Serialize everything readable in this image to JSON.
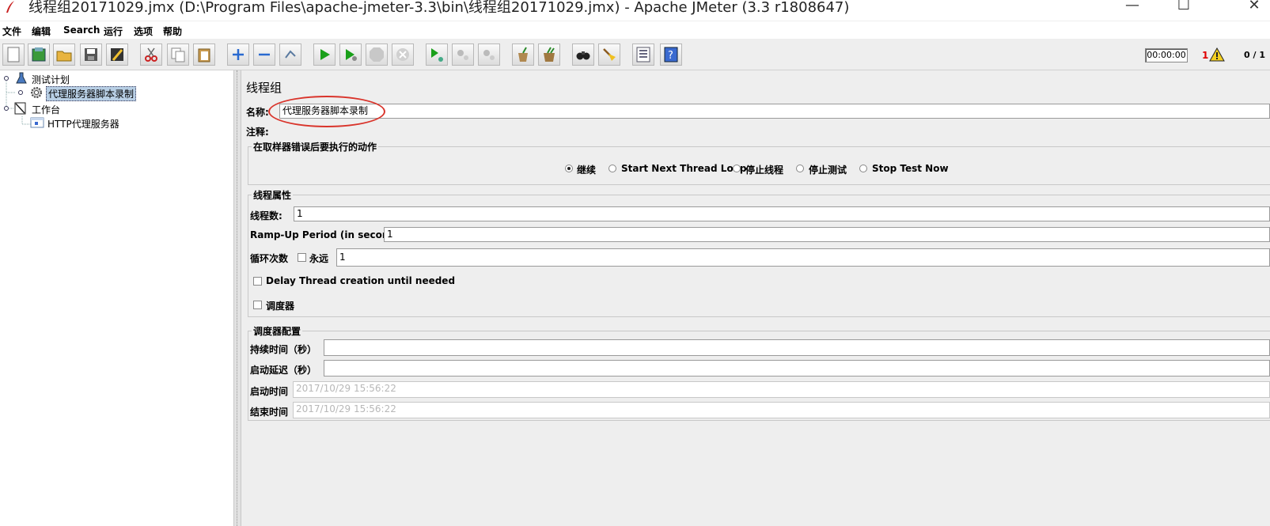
{
  "window": {
    "title": "线程组20171029.jmx (D:\\Program Files\\apache-jmeter-3.3\\bin\\线程组20171029.jmx) - Apache JMeter (3.3 r1808647)",
    "minimize_glyph": "—",
    "maximize_glyph": "☐",
    "close_glyph": "✕"
  },
  "menu": [
    "文件",
    "编辑",
    "Search",
    "运行",
    "选项",
    "帮助"
  ],
  "toolbar": {
    "buttons": [
      "new-icon",
      "templates-icon",
      "open-icon",
      "save-icon",
      "save-as-icon",
      "cut-icon",
      "copy-icon",
      "paste-icon",
      "expand-icon",
      "collapse-icon",
      "toggle-icon",
      "start-icon",
      "start-no-pause-icon",
      "stop-icon",
      "shutdown-icon",
      "remote-start-icon",
      "remote-stop-icon",
      "remote-shutdown-icon",
      "clear-icon",
      "clear-all-icon",
      "search-icon",
      "reset-search-icon",
      "function-helper-icon",
      "help-icon"
    ],
    "timer": "00:00:00",
    "error_count": "1",
    "thread_count": "0 / 1"
  },
  "tree": {
    "test_plan": "测试计划",
    "thread_group": "代理服务器脚本录制",
    "workbench": "工作台",
    "http_proxy": "HTTP代理服务器"
  },
  "panel": {
    "title": "线程组",
    "name_label": "名称:",
    "name_value": "代理服务器脚本录制",
    "comment_label": "注释:",
    "sampler_error": {
      "legend": "在取样器错误后要执行的动作",
      "options": [
        "继续",
        "Start Next Thread Loop",
        "停止线程",
        "停止测试",
        "Stop Test Now"
      ],
      "selected": "继续"
    },
    "thread_props": {
      "legend": "线程属性",
      "threads_label": "线程数:",
      "threads_value": "1",
      "rampup_label": "Ramp-Up Period (in seconds):",
      "rampup_value": "1",
      "loop_label": "循环次数",
      "forever_label": "永远",
      "loop_value": "1",
      "delay_label": "Delay Thread creation until needed",
      "scheduler_label": "调度器"
    },
    "scheduler": {
      "legend": "调度器配置",
      "duration_label": "持续时间（秒）",
      "duration_value": "",
      "delay_label": "启动延迟（秒）",
      "delay_value": "",
      "start_label": "启动时间",
      "start_value": "2017/10/29 15:56:22",
      "end_label": "结束时间",
      "end_value": "2017/10/29 15:56:22"
    }
  },
  "colors": {
    "annotation": "#d9342b",
    "selection": "#b8cfe5",
    "play": "#1aa01a"
  }
}
